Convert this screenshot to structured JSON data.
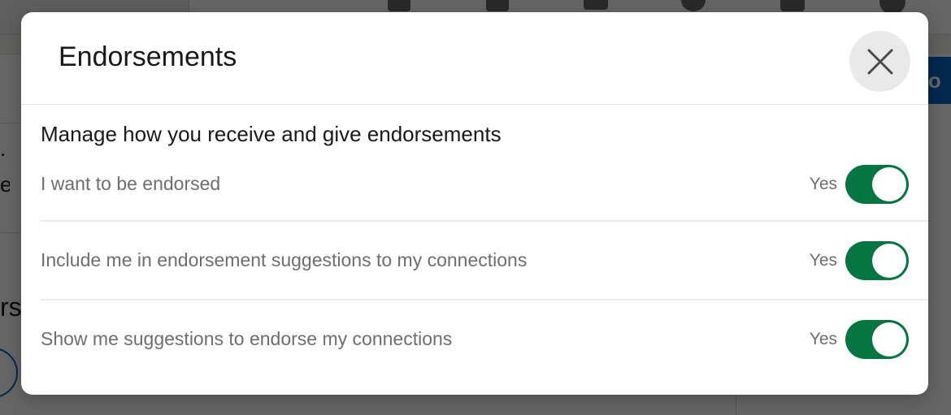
{
  "background": {
    "right_button_fragment": "tio",
    "left_text_fragments": [
      ".",
      "e",
      "rse"
    ]
  },
  "modal": {
    "title": "Endorsements",
    "close_icon": "close-icon",
    "section_heading": "Manage how you receive and give endorsements",
    "settings": [
      {
        "label": "I want to be endorsed",
        "state": "Yes",
        "on": true
      },
      {
        "label": "Include me in endorsement suggestions to my connections",
        "state": "Yes",
        "on": true
      },
      {
        "label": "Show me suggestions to endorse my connections",
        "state": "Yes",
        "on": true
      }
    ]
  },
  "colors": {
    "toggle_on": "#057642",
    "scrim": "rgba(0,0,0,0.6)",
    "background_button": "#0a66c2"
  }
}
